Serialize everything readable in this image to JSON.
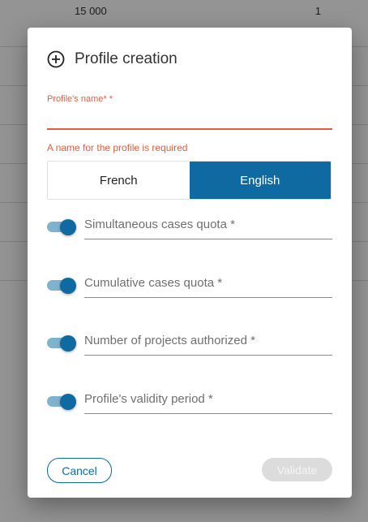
{
  "background_table": {
    "first_row": {
      "value": "15 000",
      "count": "1"
    }
  },
  "dialog": {
    "title": "Profile creation",
    "icon": "add-circle-icon",
    "name_field": {
      "label": "Profile's name* *",
      "value": "",
      "error": "A name for the profile is required"
    },
    "language_toggle": {
      "options": [
        "French",
        "English"
      ],
      "selected": "English"
    },
    "quotas": [
      {
        "label": "Simultaneous cases quota *",
        "enabled": true
      },
      {
        "label": "Cumulative cases quota *",
        "enabled": true
      },
      {
        "label": "Number of projects authorized *",
        "enabled": true
      },
      {
        "label": "Profile's validity period *",
        "enabled": true
      }
    ],
    "buttons": {
      "cancel": "Cancel",
      "validate": "Validate"
    }
  },
  "colors": {
    "primary": "#0e6aa0",
    "error": "#e25c3f",
    "disabled": "#dcdcdc"
  }
}
